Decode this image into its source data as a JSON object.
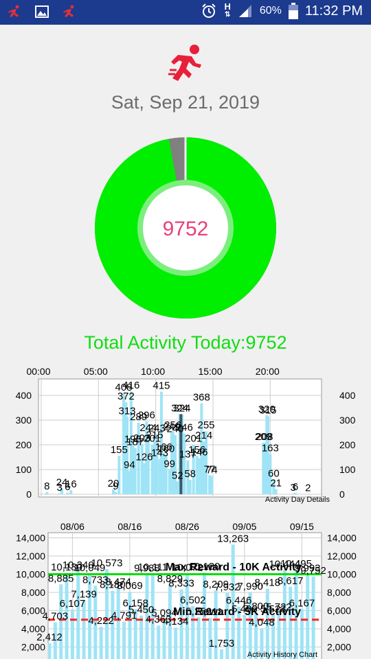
{
  "status_bar": {
    "time": "11:32 PM",
    "battery": "60%",
    "network": "H",
    "icons": [
      "runner-icon",
      "gallery-icon",
      "runner-icon",
      "alarm-icon",
      "network-h-icon",
      "signal-icon",
      "battery-icon"
    ]
  },
  "header": {
    "logo_icon": "runner-icon",
    "date": "Sat, Sep 21, 2019"
  },
  "donut": {
    "center_value": "9752",
    "progress_fraction": 0.97,
    "colors": {
      "progress": "#00ee00",
      "remainder": "#808080",
      "inner_ring": "#7dee7d",
      "value_text": "#e8407a"
    }
  },
  "total_activity": {
    "label": "Total Activity Today:9752"
  },
  "chart_data": [
    {
      "type": "bar",
      "caption": "Activity Day Details",
      "x_tick_labels": [
        "00:00",
        "05:00",
        "10:00",
        "15:00",
        "20:00"
      ],
      "y_tick_labels": [
        "0",
        "100",
        "200",
        "300",
        "400"
      ],
      "ylim": [
        0,
        440
      ],
      "x_hours_range": [
        0,
        24
      ],
      "bar_color": "#9fe4f6",
      "highlight_color": "#3a5a6a",
      "grid": true,
      "points": [
        {
          "h": 0.5,
          "v": 8
        },
        {
          "h": 1.6,
          "v": 3
        },
        {
          "h": 1.8,
          "v": 24
        },
        {
          "h": 2.3,
          "v": 6
        },
        {
          "h": 2.6,
          "v": 16
        },
        {
          "h": 6.3,
          "v": 20
        },
        {
          "h": 6.5,
          "v": 9
        },
        {
          "h": 6.8,
          "v": 155
        },
        {
          "h": 7.2,
          "v": 408
        },
        {
          "h": 7.4,
          "v": 372
        },
        {
          "h": 7.5,
          "v": 313
        },
        {
          "h": 7.7,
          "v": 94
        },
        {
          "h": 7.85,
          "v": 416
        },
        {
          "h": 8.0,
          "v": 198
        },
        {
          "h": 8.2,
          "v": 187
        },
        {
          "h": 8.5,
          "v": 289
        },
        {
          "h": 8.8,
          "v": 203
        },
        {
          "h": 9.0,
          "v": 126
        },
        {
          "h": 9.2,
          "v": 296
        },
        {
          "h": 9.35,
          "v": 244
        },
        {
          "h": 9.7,
          "v": 201
        },
        {
          "h": 9.9,
          "v": 215
        },
        {
          "h": 10.1,
          "v": 243
        },
        {
          "h": 10.35,
          "v": 143
        },
        {
          "h": 10.5,
          "v": 415
        },
        {
          "h": 10.7,
          "v": 166
        },
        {
          "h": 10.9,
          "v": 160
        },
        {
          "h": 11.2,
          "v": 99
        },
        {
          "h": 11.4,
          "v": 249
        },
        {
          "h": 11.5,
          "v": 256
        },
        {
          "h": 11.7,
          "v": 240
        },
        {
          "h": 11.9,
          "v": 52
        },
        {
          "h": 12.1,
          "v": 324
        },
        {
          "h": 12.3,
          "v": 324
        },
        {
          "h": 12.5,
          "v": 246
        },
        {
          "h": 12.8,
          "v": 137
        },
        {
          "h": 13.0,
          "v": 58
        },
        {
          "h": 13.3,
          "v": 201
        },
        {
          "h": 13.6,
          "v": 156
        },
        {
          "h": 13.8,
          "v": 146
        },
        {
          "h": 14.0,
          "v": 368
        },
        {
          "h": 14.2,
          "v": 214
        },
        {
          "h": 14.4,
          "v": 255
        },
        {
          "h": 14.7,
          "v": 77
        },
        {
          "h": 14.9,
          "v": 74
        },
        {
          "h": 19.4,
          "v": 209
        },
        {
          "h": 19.5,
          "v": 208
        },
        {
          "h": 19.7,
          "v": 320
        },
        {
          "h": 19.8,
          "v": 315
        },
        {
          "h": 20.0,
          "v": 163
        },
        {
          "h": 20.3,
          "v": 60
        },
        {
          "h": 20.5,
          "v": 21
        },
        {
          "h": 22.0,
          "v": 3
        },
        {
          "h": 22.2,
          "v": 6
        },
        {
          "h": 23.3,
          "v": 2
        }
      ],
      "highlight_point": {
        "h": 12.2,
        "v": 324
      },
      "labels": [
        {
          "text": "8",
          "h": 0.5,
          "v": 8
        },
        {
          "text": "3",
          "h": 1.6,
          "v": 3
        },
        {
          "text": "24",
          "h": 1.8,
          "v": 24
        },
        {
          "text": "6",
          "h": 2.3,
          "v": 6
        },
        {
          "text": "16",
          "h": 2.6,
          "v": 16
        },
        {
          "text": "20",
          "h": 6.3,
          "v": 20
        },
        {
          "text": "9",
          "h": 6.5,
          "v": 9
        },
        {
          "text": "155",
          "h": 6.8,
          "v": 155
        },
        {
          "text": "408",
          "h": 7.2,
          "v": 408
        },
        {
          "text": "372",
          "h": 7.4,
          "v": 372
        },
        {
          "text": "313",
          "h": 7.5,
          "v": 313
        },
        {
          "text": "94",
          "h": 7.7,
          "v": 94
        },
        {
          "text": "416",
          "h": 7.85,
          "v": 416
        },
        {
          "text": "198",
          "h": 8.0,
          "v": 198
        },
        {
          "text": "187",
          "h": 8.2,
          "v": 187
        },
        {
          "text": "289",
          "h": 8.5,
          "v": 289
        },
        {
          "text": "203",
          "h": 8.8,
          "v": 203
        },
        {
          "text": "126",
          "h": 9.0,
          "v": 126
        },
        {
          "text": "296",
          "h": 9.2,
          "v": 296
        },
        {
          "text": "244",
          "h": 9.35,
          "v": 244
        },
        {
          "text": "201",
          "h": 9.7,
          "v": 201
        },
        {
          "text": "215",
          "h": 9.9,
          "v": 215
        },
        {
          "text": "243",
          "h": 10.1,
          "v": 243
        },
        {
          "text": "143",
          "h": 10.35,
          "v": 143
        },
        {
          "text": "415",
          "h": 10.5,
          "v": 415
        },
        {
          "text": "166",
          "h": 10.7,
          "v": 166
        },
        {
          "text": "160",
          "h": 10.9,
          "v": 160
        },
        {
          "text": "99",
          "h": 11.2,
          "v": 99
        },
        {
          "text": "249",
          "h": 11.4,
          "v": 249
        },
        {
          "text": "256",
          "h": 11.5,
          "v": 256
        },
        {
          "text": "240",
          "h": 11.7,
          "v": 240
        },
        {
          "text": "52",
          "h": 11.9,
          "v": 52
        },
        {
          "text": "324",
          "h": 12.1,
          "v": 324
        },
        {
          "text": "324",
          "h": 12.3,
          "v": 324
        },
        {
          "text": "246",
          "h": 12.5,
          "v": 246
        },
        {
          "text": "137",
          "h": 12.8,
          "v": 137
        },
        {
          "text": "58",
          "h": 13.0,
          "v": 58
        },
        {
          "text": "201",
          "h": 13.3,
          "v": 201
        },
        {
          "text": "156",
          "h": 13.6,
          "v": 156
        },
        {
          "text": "146",
          "h": 13.8,
          "v": 146
        },
        {
          "text": "368",
          "h": 14.0,
          "v": 368
        },
        {
          "text": "214",
          "h": 14.2,
          "v": 214
        },
        {
          "text": "255",
          "h": 14.4,
          "v": 255
        },
        {
          "text": "77",
          "h": 14.7,
          "v": 77
        },
        {
          "text": "74",
          "h": 14.9,
          "v": 74
        },
        {
          "text": "209",
          "h": 19.4,
          "v": 209
        },
        {
          "text": "208",
          "h": 19.5,
          "v": 208
        },
        {
          "text": "320",
          "h": 19.7,
          "v": 320
        },
        {
          "text": "315",
          "h": 19.8,
          "v": 315
        },
        {
          "text": "163",
          "h": 20.0,
          "v": 163
        },
        {
          "text": "60",
          "h": 20.3,
          "v": 60
        },
        {
          "text": "21",
          "h": 20.5,
          "v": 21
        },
        {
          "text": "3",
          "h": 22.0,
          "v": 3
        },
        {
          "text": "6",
          "h": 22.2,
          "v": 6
        },
        {
          "text": "2",
          "h": 23.3,
          "v": 2
        }
      ]
    },
    {
      "type": "bar",
      "caption": "Activity History Chart",
      "x_tick_labels": [
        "08/06",
        "08/16",
        "08/26",
        "09/05",
        "09/15"
      ],
      "y_tick_labels": [
        "2,000",
        "4,000",
        "6,000",
        "8,000",
        "10,000",
        "12,000",
        "14,000"
      ],
      "ylim": [
        0,
        14800
      ],
      "x_day_range": [
        0,
        47
      ],
      "x_tick_days": [
        4,
        14,
        24,
        34,
        44
      ],
      "bar_color": "#9fe4f6",
      "grid": true,
      "reference_lines": [
        {
          "name": "Max Reward - 10K Activity",
          "value": 10000,
          "color": "#00dd00",
          "style": "solid"
        },
        {
          "name": "Min Reward - 5K Activity",
          "value": 5000,
          "color": "#ff2222",
          "style": "dashed"
        }
      ],
      "values": [
        2412,
        4703,
        8885,
        10130,
        6107,
        10340,
        7139,
        10049,
        8733,
        4222,
        10573,
        8180,
        8474,
        4791,
        8069,
        6158,
        5450,
        9988,
        10111,
        4363,
        5094,
        8829,
        4134,
        8333,
        10072,
        6502,
        5256,
        10180,
        5211,
        8209,
        1753,
        7932,
        13263,
        6446,
        5496,
        7990,
        5800,
        4048,
        8418,
        5523,
        5722,
        10444,
        8617,
        10495,
        6167,
        9993,
        9752
      ],
      "labels": [
        {
          "text": "2,412",
          "day": 0,
          "v": 2412
        },
        {
          "text": "4,703",
          "day": 1,
          "v": 4703
        },
        {
          "text": "8,885",
          "day": 2,
          "v": 8885
        },
        {
          "text": "10,130",
          "day": 3,
          "v": 10130
        },
        {
          "text": "6,107",
          "day": 4,
          "v": 6107
        },
        {
          "text": "10,340",
          "day": 5,
          "v": 10340
        },
        {
          "text": "7,139",
          "day": 6,
          "v": 7139
        },
        {
          "text": "10,049",
          "day": 7,
          "v": 10049
        },
        {
          "text": "8,733",
          "day": 8,
          "v": 8733
        },
        {
          "text": "4,222",
          "day": 9,
          "v": 4222
        },
        {
          "text": "10,573",
          "day": 10,
          "v": 10573
        },
        {
          "text": "8,180",
          "day": 11,
          "v": 8180
        },
        {
          "text": "8,474",
          "day": 12,
          "v": 8474
        },
        {
          "text": "4,791",
          "day": 13,
          "v": 4791
        },
        {
          "text": "8,069",
          "day": 14,
          "v": 8069
        },
        {
          "text": "6,158",
          "day": 15,
          "v": 6158
        },
        {
          "text": "5,450",
          "day": 16,
          "v": 5450
        },
        {
          "text": "9,988",
          "day": 17,
          "v": 9988
        },
        {
          "text": "10,111",
          "day": 18,
          "v": 10111
        },
        {
          "text": "4,363",
          "day": 19,
          "v": 4363
        },
        {
          "text": "5,094",
          "day": 20,
          "v": 5094
        },
        {
          "text": "8,829",
          "day": 21,
          "v": 8829
        },
        {
          "text": "4,134",
          "day": 22,
          "v": 4134
        },
        {
          "text": "8,333",
          "day": 23,
          "v": 8333
        },
        {
          "text": "10,072",
          "day": 24,
          "v": 10072
        },
        {
          "text": "6,502",
          "day": 25,
          "v": 6502
        },
        {
          "text": "5,256",
          "day": 26,
          "v": 5256
        },
        {
          "text": "10,180",
          "day": 27,
          "v": 10180
        },
        {
          "text": "5,211",
          "day": 28,
          "v": 5211
        },
        {
          "text": "8,209",
          "day": 29,
          "v": 8209
        },
        {
          "text": "1,753",
          "day": 30,
          "v": 1753
        },
        {
          "text": "7,932",
          "day": 31,
          "v": 7932
        },
        {
          "text": "13,263",
          "day": 32,
          "v": 13263
        },
        {
          "text": "6,446",
          "day": 33,
          "v": 6446
        },
        {
          "text": "5,496",
          "day": 34,
          "v": 5496
        },
        {
          "text": "7,990",
          "day": 35,
          "v": 7990
        },
        {
          "text": "5,800",
          "day": 36,
          "v": 5800
        },
        {
          "text": "4,048",
          "day": 37,
          "v": 4048
        },
        {
          "text": "8,418",
          "day": 38,
          "v": 8418
        },
        {
          "text": "5,523",
          "day": 39,
          "v": 5523
        },
        {
          "text": "5,722",
          "day": 40,
          "v": 5722
        },
        {
          "text": "10,444",
          "day": 41,
          "v": 10444
        },
        {
          "text": "8,617",
          "day": 42,
          "v": 8617
        },
        {
          "text": "10,495",
          "day": 43,
          "v": 10495
        },
        {
          "text": "6,167",
          "day": 44,
          "v": 6167
        },
        {
          "text": "9,993",
          "day": 45,
          "v": 9993
        },
        {
          "text": "9,752",
          "day": 46,
          "v": 9752
        }
      ]
    }
  ]
}
